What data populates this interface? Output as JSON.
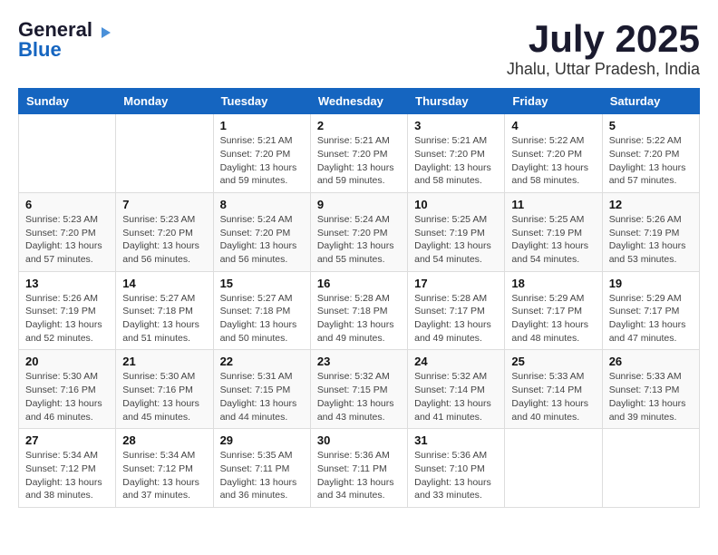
{
  "header": {
    "logo_general": "General",
    "logo_blue": "Blue",
    "month": "July 2025",
    "location": "Jhalu, Uttar Pradesh, India"
  },
  "calendar": {
    "days_of_week": [
      "Sunday",
      "Monday",
      "Tuesday",
      "Wednesday",
      "Thursday",
      "Friday",
      "Saturday"
    ],
    "weeks": [
      [
        {
          "day": "",
          "info": ""
        },
        {
          "day": "",
          "info": ""
        },
        {
          "day": "1",
          "info": "Sunrise: 5:21 AM\nSunset: 7:20 PM\nDaylight: 13 hours\nand 59 minutes."
        },
        {
          "day": "2",
          "info": "Sunrise: 5:21 AM\nSunset: 7:20 PM\nDaylight: 13 hours\nand 59 minutes."
        },
        {
          "day": "3",
          "info": "Sunrise: 5:21 AM\nSunset: 7:20 PM\nDaylight: 13 hours\nand 58 minutes."
        },
        {
          "day": "4",
          "info": "Sunrise: 5:22 AM\nSunset: 7:20 PM\nDaylight: 13 hours\nand 58 minutes."
        },
        {
          "day": "5",
          "info": "Sunrise: 5:22 AM\nSunset: 7:20 PM\nDaylight: 13 hours\nand 57 minutes."
        }
      ],
      [
        {
          "day": "6",
          "info": "Sunrise: 5:23 AM\nSunset: 7:20 PM\nDaylight: 13 hours\nand 57 minutes."
        },
        {
          "day": "7",
          "info": "Sunrise: 5:23 AM\nSunset: 7:20 PM\nDaylight: 13 hours\nand 56 minutes."
        },
        {
          "day": "8",
          "info": "Sunrise: 5:24 AM\nSunset: 7:20 PM\nDaylight: 13 hours\nand 56 minutes."
        },
        {
          "day": "9",
          "info": "Sunrise: 5:24 AM\nSunset: 7:20 PM\nDaylight: 13 hours\nand 55 minutes."
        },
        {
          "day": "10",
          "info": "Sunrise: 5:25 AM\nSunset: 7:19 PM\nDaylight: 13 hours\nand 54 minutes."
        },
        {
          "day": "11",
          "info": "Sunrise: 5:25 AM\nSunset: 7:19 PM\nDaylight: 13 hours\nand 54 minutes."
        },
        {
          "day": "12",
          "info": "Sunrise: 5:26 AM\nSunset: 7:19 PM\nDaylight: 13 hours\nand 53 minutes."
        }
      ],
      [
        {
          "day": "13",
          "info": "Sunrise: 5:26 AM\nSunset: 7:19 PM\nDaylight: 13 hours\nand 52 minutes."
        },
        {
          "day": "14",
          "info": "Sunrise: 5:27 AM\nSunset: 7:18 PM\nDaylight: 13 hours\nand 51 minutes."
        },
        {
          "day": "15",
          "info": "Sunrise: 5:27 AM\nSunset: 7:18 PM\nDaylight: 13 hours\nand 50 minutes."
        },
        {
          "day": "16",
          "info": "Sunrise: 5:28 AM\nSunset: 7:18 PM\nDaylight: 13 hours\nand 49 minutes."
        },
        {
          "day": "17",
          "info": "Sunrise: 5:28 AM\nSunset: 7:17 PM\nDaylight: 13 hours\nand 49 minutes."
        },
        {
          "day": "18",
          "info": "Sunrise: 5:29 AM\nSunset: 7:17 PM\nDaylight: 13 hours\nand 48 minutes."
        },
        {
          "day": "19",
          "info": "Sunrise: 5:29 AM\nSunset: 7:17 PM\nDaylight: 13 hours\nand 47 minutes."
        }
      ],
      [
        {
          "day": "20",
          "info": "Sunrise: 5:30 AM\nSunset: 7:16 PM\nDaylight: 13 hours\nand 46 minutes."
        },
        {
          "day": "21",
          "info": "Sunrise: 5:30 AM\nSunset: 7:16 PM\nDaylight: 13 hours\nand 45 minutes."
        },
        {
          "day": "22",
          "info": "Sunrise: 5:31 AM\nSunset: 7:15 PM\nDaylight: 13 hours\nand 44 minutes."
        },
        {
          "day": "23",
          "info": "Sunrise: 5:32 AM\nSunset: 7:15 PM\nDaylight: 13 hours\nand 43 minutes."
        },
        {
          "day": "24",
          "info": "Sunrise: 5:32 AM\nSunset: 7:14 PM\nDaylight: 13 hours\nand 41 minutes."
        },
        {
          "day": "25",
          "info": "Sunrise: 5:33 AM\nSunset: 7:14 PM\nDaylight: 13 hours\nand 40 minutes."
        },
        {
          "day": "26",
          "info": "Sunrise: 5:33 AM\nSunset: 7:13 PM\nDaylight: 13 hours\nand 39 minutes."
        }
      ],
      [
        {
          "day": "27",
          "info": "Sunrise: 5:34 AM\nSunset: 7:12 PM\nDaylight: 13 hours\nand 38 minutes."
        },
        {
          "day": "28",
          "info": "Sunrise: 5:34 AM\nSunset: 7:12 PM\nDaylight: 13 hours\nand 37 minutes."
        },
        {
          "day": "29",
          "info": "Sunrise: 5:35 AM\nSunset: 7:11 PM\nDaylight: 13 hours\nand 36 minutes."
        },
        {
          "day": "30",
          "info": "Sunrise: 5:36 AM\nSunset: 7:11 PM\nDaylight: 13 hours\nand 34 minutes."
        },
        {
          "day": "31",
          "info": "Sunrise: 5:36 AM\nSunset: 7:10 PM\nDaylight: 13 hours\nand 33 minutes."
        },
        {
          "day": "",
          "info": ""
        },
        {
          "day": "",
          "info": ""
        }
      ]
    ]
  }
}
